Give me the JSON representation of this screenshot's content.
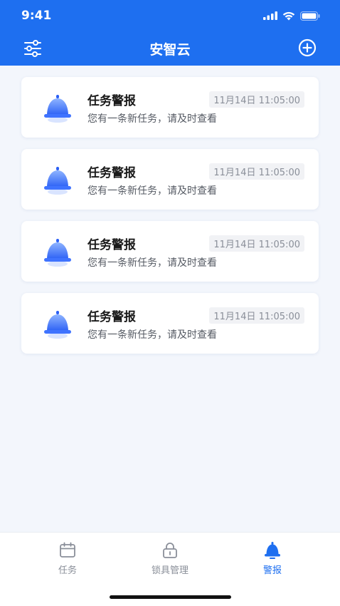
{
  "status": {
    "time": "9:41"
  },
  "nav": {
    "title": "安智云",
    "left_icon": "filter-sliders-icon",
    "right_icon": "plus-circle-icon"
  },
  "colors": {
    "primary": "#1e6ff0",
    "background": "#f3f6fc"
  },
  "alerts": [
    {
      "title": "任务警报",
      "time": "11月14日 11:05:00",
      "desc": "您有一条新任务，请及时查看",
      "icon": "bell-icon"
    },
    {
      "title": "任务警报",
      "time": "11月14日 11:05:00",
      "desc": "您有一条新任务，请及时查看",
      "icon": "bell-icon"
    },
    {
      "title": "任务警报",
      "time": "11月14日 11:05:00",
      "desc": "您有一条新任务，请及时查看",
      "icon": "bell-icon"
    },
    {
      "title": "任务警报",
      "time": "11月14日 11:05:00",
      "desc": "您有一条新任务，请及时查看",
      "icon": "bell-icon"
    }
  ],
  "tabbar": {
    "items": [
      {
        "label": "任务",
        "icon": "calendar-icon",
        "active": false
      },
      {
        "label": "锁具管理",
        "icon": "lock-icon",
        "active": false
      },
      {
        "label": "警报",
        "icon": "bell-icon",
        "active": true
      }
    ]
  }
}
